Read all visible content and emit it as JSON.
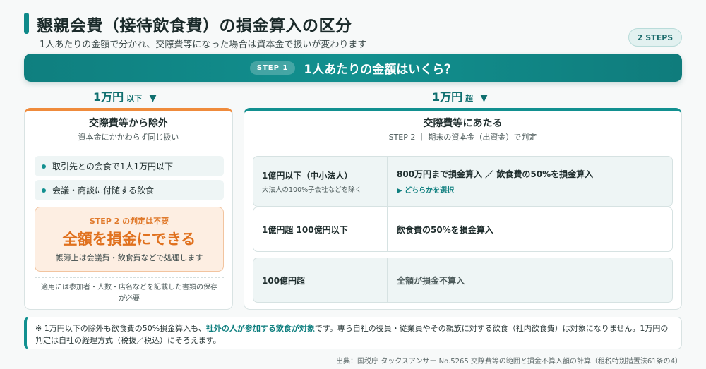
{
  "header": {
    "title": "懇親会費（接待飲食費）の損金算入の区分",
    "subtitle": "1人あたりの金額で分かれ、交際費等になった場合は資本金で扱いが変わります",
    "badge": "2 STEPS"
  },
  "step1": {
    "pill": "STEP 1",
    "question": "1人あたりの金額はいくら？"
  },
  "branches": {
    "left": {
      "amount": "1万円",
      "suffix": "以下",
      "arrow": "▼"
    },
    "right": {
      "amount": "1万円",
      "suffix": "超",
      "arrow": "▼"
    }
  },
  "left_card": {
    "title": "交際費等から除外",
    "subtitle": "資本金にかかわらず同じ扱い",
    "bullets": [
      "取引先との会食で1人1万円以下",
      "会議・商談に付随する飲食"
    ],
    "result_note": "STEP 2 の判定は不要",
    "result_main": "全額を損金にできる",
    "result_desc": "帳簿上は会議費・飲食費などで処理します",
    "footer_line1": "適用には参加者・人数・店名などを記載した書類の保存",
    "footer_line2": "が必要"
  },
  "right_card": {
    "title": "交際費等にあたる",
    "subtitle": "STEP 2 ｜ 期末の資本金（出資金）で判定",
    "rows": [
      {
        "label": "1億円以下（中小法人）",
        "sublabel": "大法人の100%子会社などを除く",
        "value": "800万円まで損金算入 ／ 飲食費の50%を損金算入",
        "choice": "▶ どちらかを選択"
      },
      {
        "label": "1億円超 100億円以下",
        "value": "飲食費の50%を損金算入"
      },
      {
        "label": "100億円超",
        "value": "全額が損金不算入"
      }
    ]
  },
  "footnote": {
    "prefix": "※ 1万円以下の除外も飲食費の50%損金算入も、",
    "highlight": "社外の人が参加する飲食が対象",
    "suffix": "です。専ら自社の役員・従業員やその親族に対する飲食（社内飲食費）は対象になりません。1万円の判定は自社の経理方式（税抜／税込）にそろえます。"
  },
  "source": "出典：国税庁 タックスアンサー No.5265 交際費等の範囲と損金不算入額の計算（租税特別措置法61条の4）",
  "colors": {
    "teal": "#129090",
    "orange": "#ef8b3c",
    "result_text": "#e0711e"
  }
}
